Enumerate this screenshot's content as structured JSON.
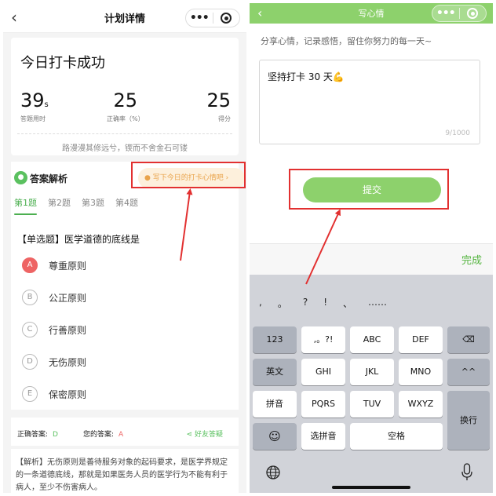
{
  "left": {
    "nav": {
      "back": "‹",
      "title": "计划详情",
      "menu": "•••"
    },
    "result": {
      "title": "今日打卡成功",
      "stats": [
        {
          "value": "39",
          "unit": "s",
          "label": "答题用时"
        },
        {
          "value": "25",
          "unit": "",
          "label": "正确率（%）"
        },
        {
          "value": "25",
          "unit": "",
          "label": "得分"
        }
      ],
      "quote": "路漫漫其修远兮，锲而不舍金石可镂"
    },
    "analysis": {
      "title": "答案解析",
      "mood_prompt": "● 写下今日的打卡心情吧 ›",
      "tabs": [
        "第1题",
        "第2题",
        "第3题",
        "第4题"
      ],
      "question": "【单选题】医学道德的底线是",
      "options": [
        {
          "letter": "A",
          "text": "尊重原则",
          "state": "wrong"
        },
        {
          "letter": "B",
          "text": "公正原则",
          "state": "normal"
        },
        {
          "letter": "C",
          "text": "行善原则",
          "state": "normal"
        },
        {
          "letter": "D",
          "text": "无伤原则",
          "state": "normal"
        },
        {
          "letter": "E",
          "text": "保密原则",
          "state": "normal"
        }
      ]
    },
    "answer": {
      "correct_label": "正确答案:",
      "correct_value": "D",
      "yours_label": "您的答案:",
      "yours_value": "A",
      "share": "好友答疑"
    },
    "explanation": "【解析】无伤原则是善待服务对象的起码要求，是医学界规定的一条道德底线，那就是如果医务人员的医学行为不能有利于病人，至少不伤害病人。"
  },
  "right": {
    "nav": {
      "back": "‹",
      "title": "写心情",
      "menu": "•••"
    },
    "subtitle": "分享心情，记录感悟，留住你努力的每一天~",
    "input_value": "坚持打卡 30 天💪",
    "counter": "9/1000",
    "submit": "提交",
    "done": "完成",
    "keyboard": {
      "candidates": [
        ",",
        "。",
        "?",
        "!",
        "、",
        "……"
      ],
      "row1": [
        "123",
        ",。?!",
        "ABC",
        "DEF",
        "⌫"
      ],
      "row2": [
        "英文",
        "GHI",
        "JKL",
        "MNO",
        "^^"
      ],
      "row3": [
        "拼音",
        "PQRS",
        "TUV",
        "WXYZ"
      ],
      "row4": [
        "☺",
        "选拼音",
        "空格"
      ],
      "enter": "换行"
    }
  },
  "colors": {
    "accent_green": "#8dd16c",
    "text_green": "#4caf50",
    "annotation_red": "#e23030",
    "wrong_red": "#ee6464",
    "mood_orange": "#e9a34a"
  }
}
